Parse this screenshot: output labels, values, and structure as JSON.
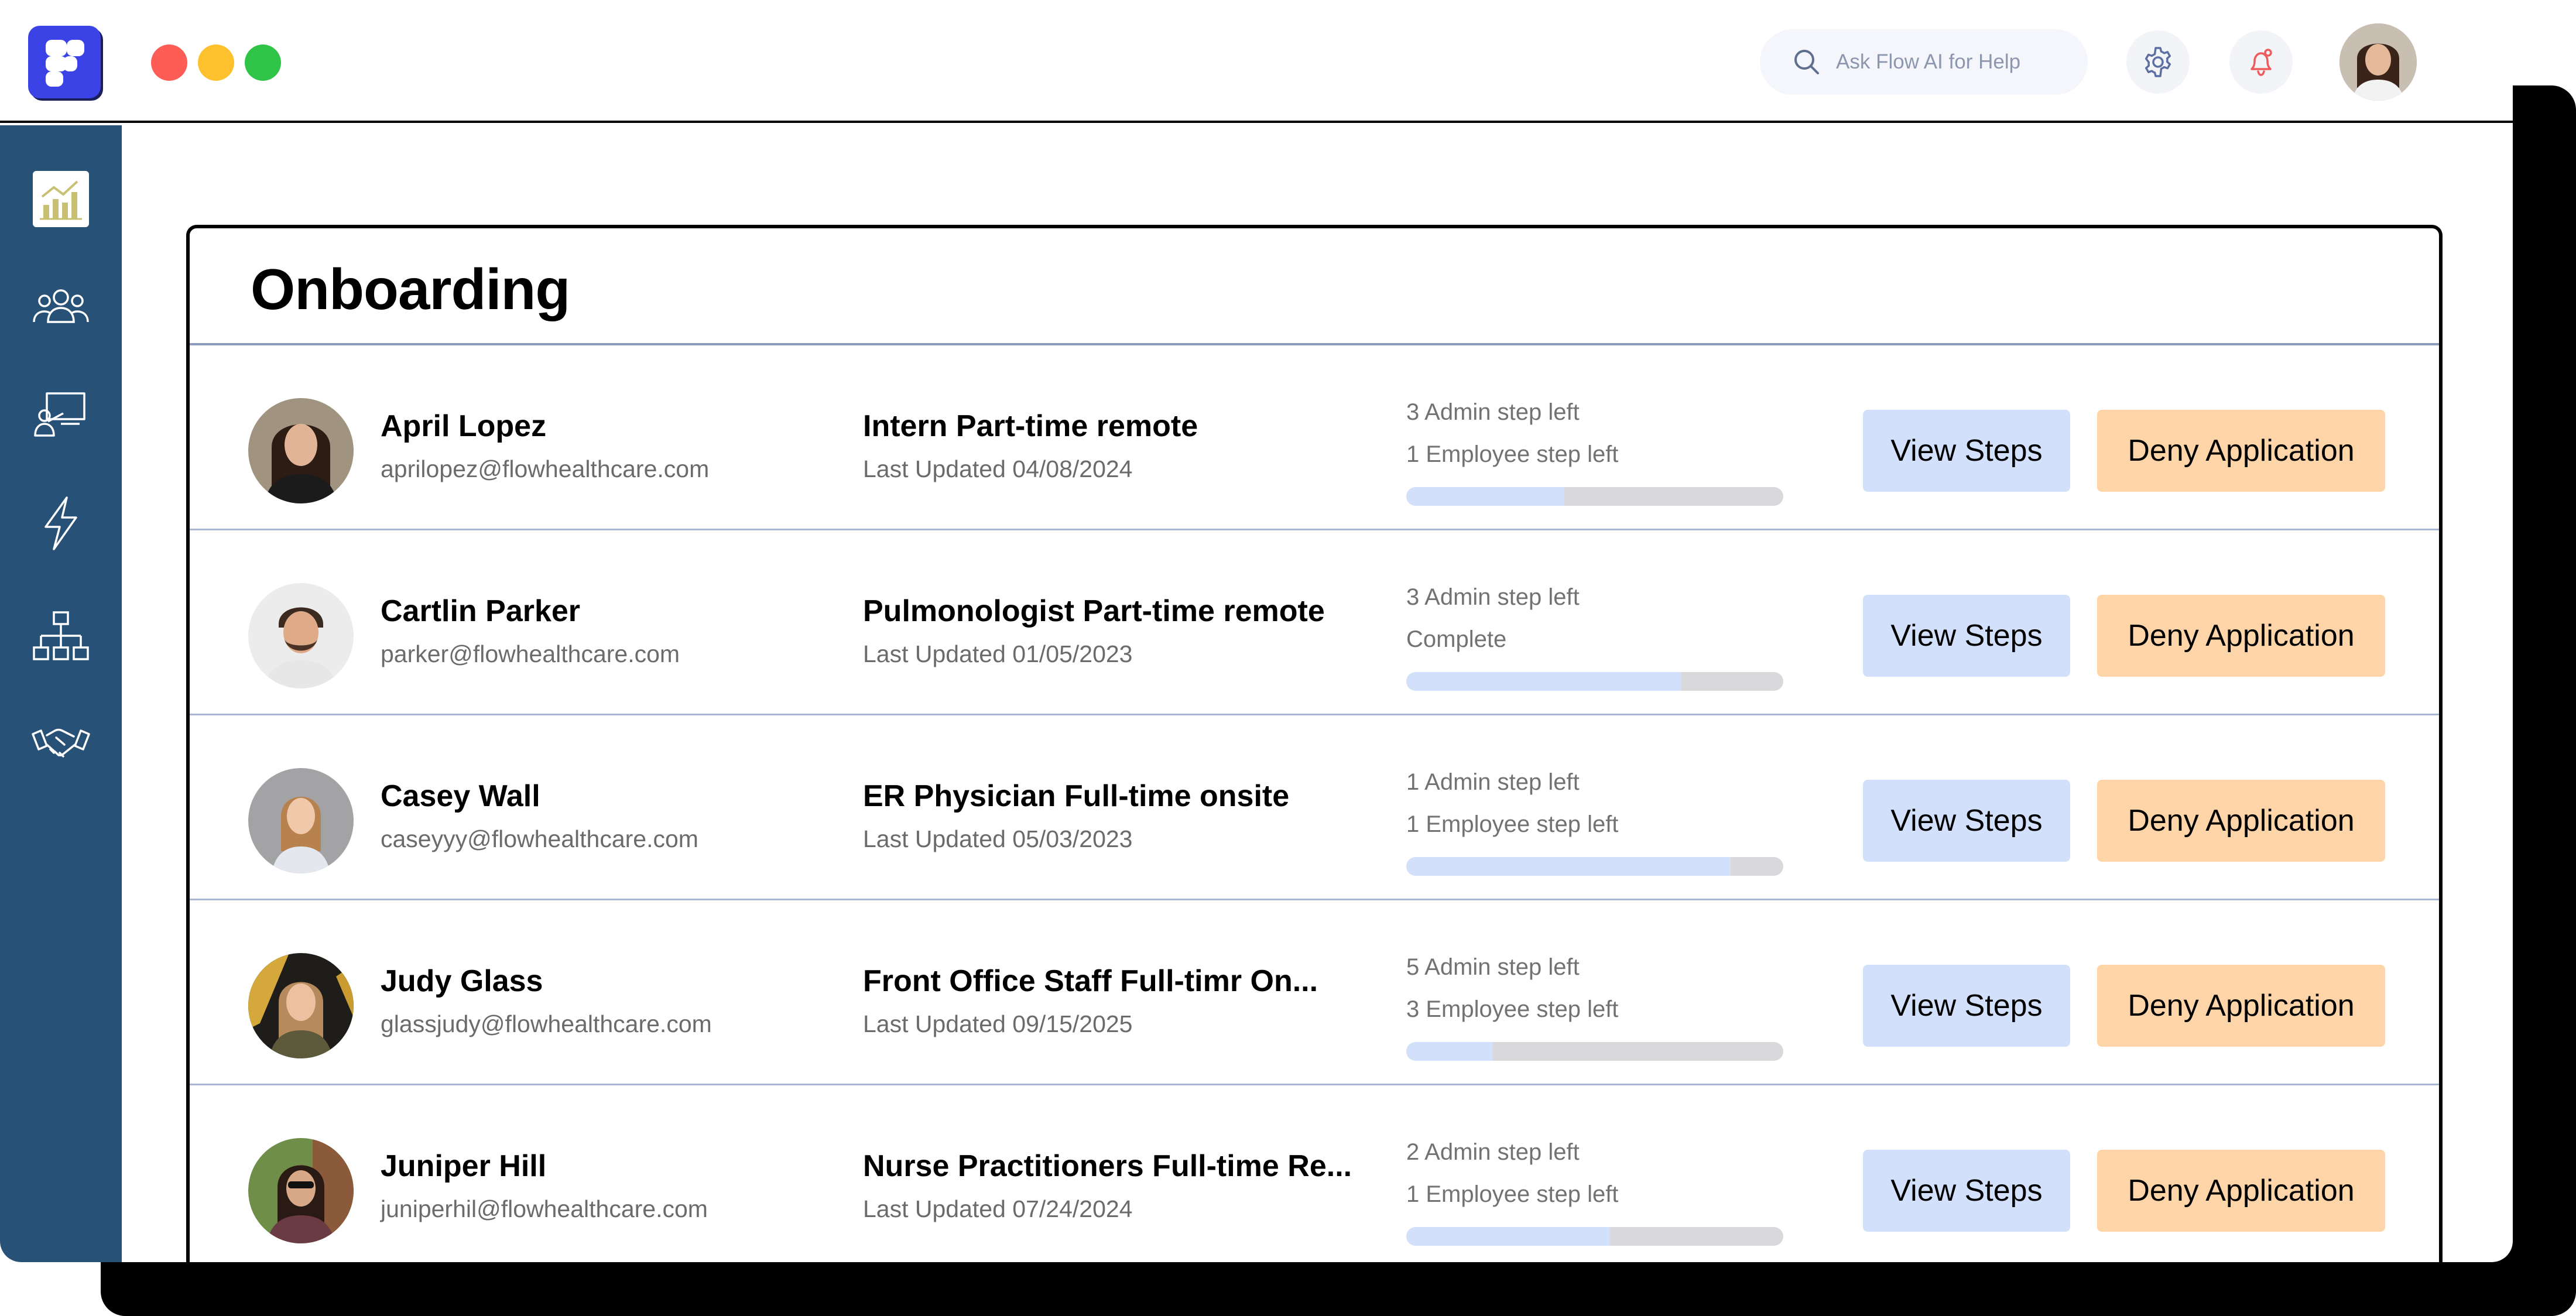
{
  "search": {
    "placeholder": "Ask Flow AI for Help"
  },
  "icons": {
    "logo": "flow-logo-icon",
    "search": "search-icon",
    "settings": "gear-icon",
    "notifications": "bell-icon",
    "sidebar": [
      "analytics-icon",
      "team-icon",
      "presentation-icon",
      "lightning-icon",
      "org-chart-icon",
      "handshake-icon"
    ]
  },
  "colors": {
    "brand": "#3b43e6",
    "sidebar": "#275176",
    "view_button": "#d3e0fc",
    "deny_button": "#fed4a9",
    "progress_track": "#d9d9dc"
  },
  "page": {
    "title": "Onboarding"
  },
  "rows": [
    {
      "name": "April Lopez",
      "email": "aprilopez@flowhealthcare.com",
      "position": "Intern Part-time remote",
      "updated": "Last Updated 04/08/2024",
      "admin_steps": "3 Admin step left",
      "employee_steps": "1 Employee step left",
      "progress": 0.42,
      "view_label": "View Steps",
      "deny_label": "Deny Application"
    },
    {
      "name": "Cartlin Parker",
      "email": "parker@flowhealthcare.com",
      "position": "Pulmonologist Part-time remote",
      "updated": "Last Updated 01/05/2023",
      "admin_steps": "3 Admin step left",
      "employee_steps": "Complete",
      "progress": 0.73,
      "view_label": "View Steps",
      "deny_label": "Deny Application"
    },
    {
      "name": "Casey Wall",
      "email": "caseyyy@flowhealthcare.com",
      "position": "ER Physician Full-time onsite",
      "updated": "Last Updated 05/03/2023",
      "admin_steps": "1 Admin step left",
      "employee_steps": "1 Employee step left",
      "progress": 0.86,
      "view_label": "View Steps",
      "deny_label": "Deny Application"
    },
    {
      "name": "Judy Glass",
      "email": "glassjudy@flowhealthcare.com",
      "position": "Front Office Staff Full-timr On...",
      "updated": "Last Updated 09/15/2025",
      "admin_steps": "5 Admin step left",
      "employee_steps": "3 Employee step left",
      "progress": 0.23,
      "view_label": "View Steps",
      "deny_label": "Deny Application"
    },
    {
      "name": "Juniper Hill",
      "email": "juniperhil@flowhealthcare.com",
      "position": "Nurse Practitioners Full-time Re...",
      "updated": "Last Updated 07/24/2024",
      "admin_steps": "2 Admin step left",
      "employee_steps": "1 Employee step left",
      "progress": 0.54,
      "view_label": "View Steps",
      "deny_label": "Deny Application"
    }
  ]
}
